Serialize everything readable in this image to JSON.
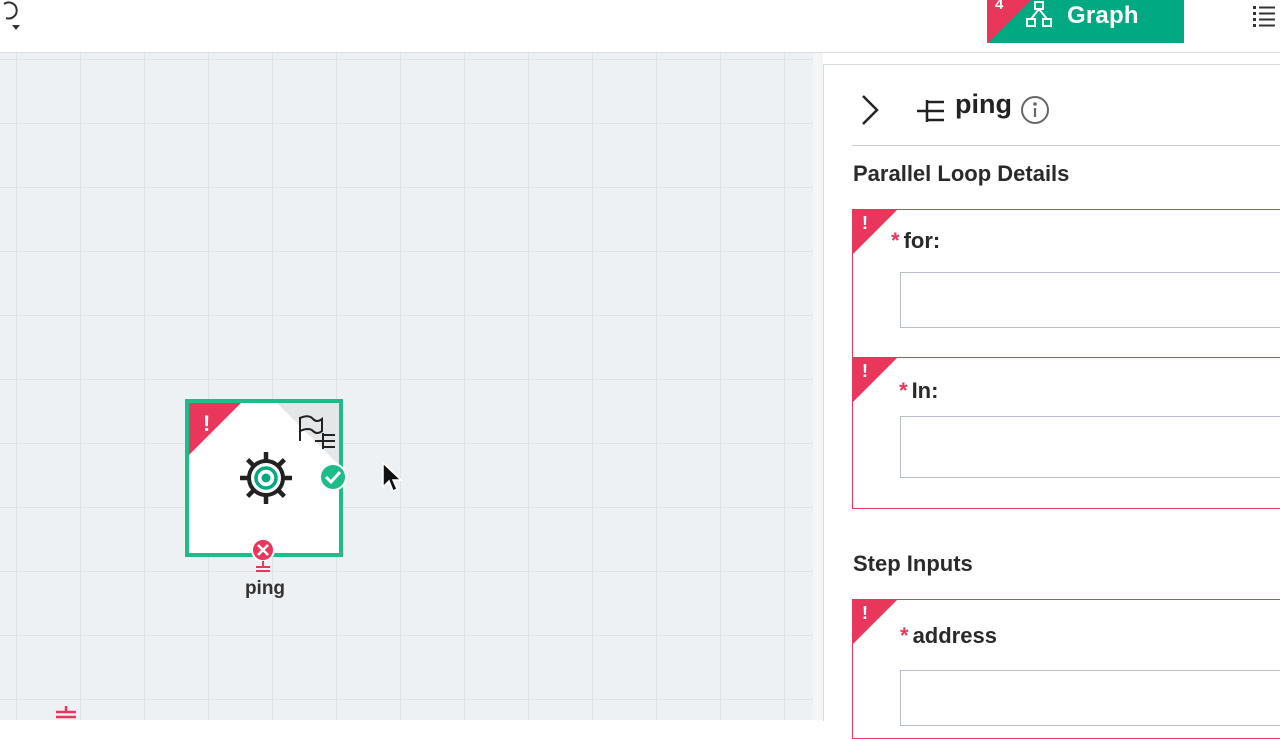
{
  "toolbar": {
    "graph_tab_label": "Graph",
    "graph_tab_badge": "4"
  },
  "canvas": {
    "node": {
      "label": "ping",
      "has_error": true,
      "error_mark": "!"
    }
  },
  "panel": {
    "step_name": "ping",
    "section_loop_title": "Parallel Loop Details",
    "fields_loop": [
      {
        "label": "for:",
        "required_mark": "*",
        "error_mark": "!",
        "value": ""
      },
      {
        "label": "In:",
        "required_mark": "*",
        "error_mark": "!",
        "value": ""
      }
    ],
    "section_inputs_title": "Step Inputs",
    "fields_inputs": [
      {
        "label": "address",
        "required_mark": "*",
        "error_mark": "!",
        "value": ""
      }
    ]
  },
  "colors": {
    "accent": "#01a982",
    "error": "#e8375a",
    "node_border": "#1dbd8a"
  },
  "icons": [
    "undo-icon",
    "graph-icon",
    "list-icon",
    "gear-icon",
    "parallel-loop-icon",
    "flag-icon",
    "check-icon",
    "close-icon",
    "chevron-right-icon",
    "info-icon",
    "mouse-cursor-icon"
  ]
}
